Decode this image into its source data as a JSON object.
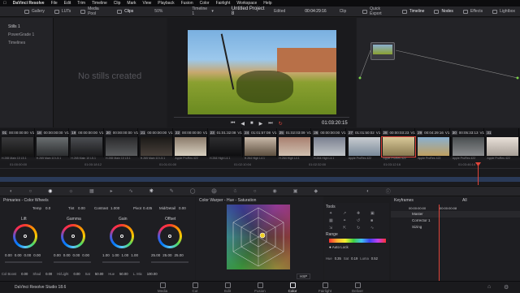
{
  "menubar": {
    "app": "DaVinci Resolve",
    "items": [
      "File",
      "Edit",
      "Trim",
      "Timeline",
      "Clip",
      "Mark",
      "View",
      "Playback",
      "Fusion",
      "Color",
      "Fairlight",
      "Workspace",
      "Help"
    ]
  },
  "toolbar": {
    "left_tabs": [
      "Gallery",
      "LUTs",
      "Media Pool",
      "Clips"
    ],
    "zoom": "50%",
    "timeline_selector": "Timeline 1",
    "project_title": "Untitled Project 8",
    "edited_label": "Edited",
    "timecode": "00:04:29:16",
    "clip_label": "Clip",
    "right_tabs": [
      "Quick Export",
      "Timeline",
      "Nodes",
      "Effects",
      "Lightbox"
    ]
  },
  "gallery": {
    "items": [
      "Stills 1",
      "PowerGrade 1",
      "Timelines"
    ],
    "empty_text": "No stills created"
  },
  "viewer": {
    "timecode": "01:03:20:15"
  },
  "timecode_strip": [
    {
      "n": "01",
      "tc": "00:00:00:00",
      "t": "V1"
    },
    {
      "n": "18",
      "tc": "00:00:00:00",
      "t": "V1"
    },
    {
      "n": "19",
      "tc": "00:00:00:00",
      "t": "V1"
    },
    {
      "n": "20",
      "tc": "00:00:00:00",
      "t": "V1"
    },
    {
      "n": "21",
      "tc": "00:00:00:00",
      "t": "V1"
    },
    {
      "n": "22",
      "tc": "00:00:00:00",
      "t": "V1"
    },
    {
      "n": "23",
      "tc": "01:01:32:08",
      "t": "V1"
    },
    {
      "n": "24",
      "tc": "01:01:57:08",
      "t": "V1"
    },
    {
      "n": "25",
      "tc": "01:02:03:09",
      "t": "V1"
    },
    {
      "n": "26",
      "tc": "00:00:00:00",
      "t": "V1"
    },
    {
      "n": "27",
      "tc": "01:01:50:02",
      "t": "V1"
    },
    {
      "n": "28",
      "tc": "00:00:03:23",
      "t": "V1"
    },
    {
      "n": "29",
      "tc": "00:04:29:16",
      "t": "V1"
    },
    {
      "n": "30",
      "tc": "00:05:33:13",
      "t": "V1"
    },
    {
      "n": "31",
      "tc": "",
      "t": ""
    }
  ],
  "clips": [
    {
      "label": "H.265 Main 10 L5.1",
      "c1": "#3a3a3c",
      "c2": "#141414"
    },
    {
      "label": "H.265 Main 10 L5.1",
      "c1": "#6a6e70",
      "c2": "#2c2e30"
    },
    {
      "label": "H.265 Main 10 L5.1",
      "c1": "#4c4e52",
      "c2": "#1a1a1c"
    },
    {
      "label": "H.265 Main 10 L5.1",
      "c1": "#2a2a2c",
      "c2": "#5a5c5e"
    },
    {
      "label": "H.265 Main 10 L5.1",
      "c1": "#1c1a18",
      "c2": "#48403a"
    },
    {
      "label": "Apple ProRes 422",
      "c1": "#8a7a6a",
      "c2": "#d8d0c0"
    },
    {
      "label": "H.264 High L4.1",
      "c1": "#2e2e30",
      "c2": "#0e0e10"
    },
    {
      "label": "H.264 High L4.1",
      "c1": "#c8b8a8",
      "c2": "#5e5040"
    },
    {
      "label": "H.264 High L4.1",
      "c1": "#a88070",
      "c2": "#d0c0b0"
    },
    {
      "label": "H.264 High L4.1",
      "c1": "#7a8090",
      "c2": "#c0c4c8"
    },
    {
      "label": "Apple ProRes 422",
      "c1": "#c8ccd0",
      "c2": "#7a8a9a"
    },
    {
      "label": "Apple ProRes 422",
      "c1": "#d8c898",
      "c2": "#8a7a50"
    },
    {
      "label": "Apple ProRes 422",
      "c1": "#8ab0d0",
      "c2": "#c0a060"
    },
    {
      "label": "Apple ProRes 422",
      "c1": "#4a4e50",
      "c2": "#8a8c8e"
    },
    {
      "label": "Apple ProRes 422",
      "c1": "#e8e0d8",
      "c2": "#a8a098"
    }
  ],
  "ruler": [
    "01:00:00:00",
    "01:00:18:12",
    "01:01:01:00",
    "01:02:10:04",
    "01:02:32:00",
    "01:03:12:16",
    "01:03:46:14"
  ],
  "primaries": {
    "title": "Primaries - Color Wheels",
    "temp_label": "Temp",
    "temp": "0.0",
    "tint_label": "Tint",
    "tint": "0.00",
    "contrast_label": "Contrast",
    "contrast": "1.000",
    "pivot_label": "Pivot",
    "pivot": "0.435",
    "middetail_label": "Mid/Detail",
    "middetail": "0.00",
    "wheels": [
      {
        "name": "Lift",
        "vals": [
          "0.00",
          "0.00",
          "0.00",
          "0.00"
        ]
      },
      {
        "name": "Gamma",
        "vals": [
          "0.00",
          "0.00",
          "0.00",
          "0.00"
        ]
      },
      {
        "name": "Gain",
        "vals": [
          "1.00",
          "1.00",
          "1.00",
          "1.00"
        ]
      },
      {
        "name": "Offset",
        "vals": [
          "25.00",
          "25.00",
          "25.00"
        ]
      }
    ],
    "bottom": [
      {
        "l": "Col Boost",
        "v": "0.00"
      },
      {
        "l": "Shad",
        "v": "0.00"
      },
      {
        "l": "Hi/Light",
        "v": "0.00"
      },
      {
        "l": "Sat",
        "v": "50.00"
      },
      {
        "l": "Hue",
        "v": "50.00"
      },
      {
        "l": "L. Mix",
        "v": "100.00"
      }
    ]
  },
  "warper": {
    "title": "Color Warper - Hue - Saturation",
    "zoom_label": "HSP"
  },
  "tools": {
    "title": "Tools",
    "range_label": "Range",
    "auto_lock": "Auto Lock",
    "hue_label": "Hue",
    "hue": "0.35",
    "sat_label": "Sat",
    "sat": "0.19",
    "luma_label": "Luma",
    "luma": "0.52"
  },
  "keyframes": {
    "title": "Keyframes",
    "filter": "All",
    "tc1": "00:00:00:00",
    "tc2": "00:00:00:08",
    "tracks": [
      "Master",
      "Corrector 1",
      "Sizing"
    ]
  },
  "pages": {
    "app_name": "DaVinci Resolve Studio 18.6",
    "items": [
      "Media",
      "Cut",
      "Edit",
      "Fusion",
      "Color",
      "Fairlight",
      "Deliver"
    ],
    "active": "Color"
  },
  "colors": {
    "accent": "#e0453a",
    "active_tab": "#e8e8ee"
  }
}
